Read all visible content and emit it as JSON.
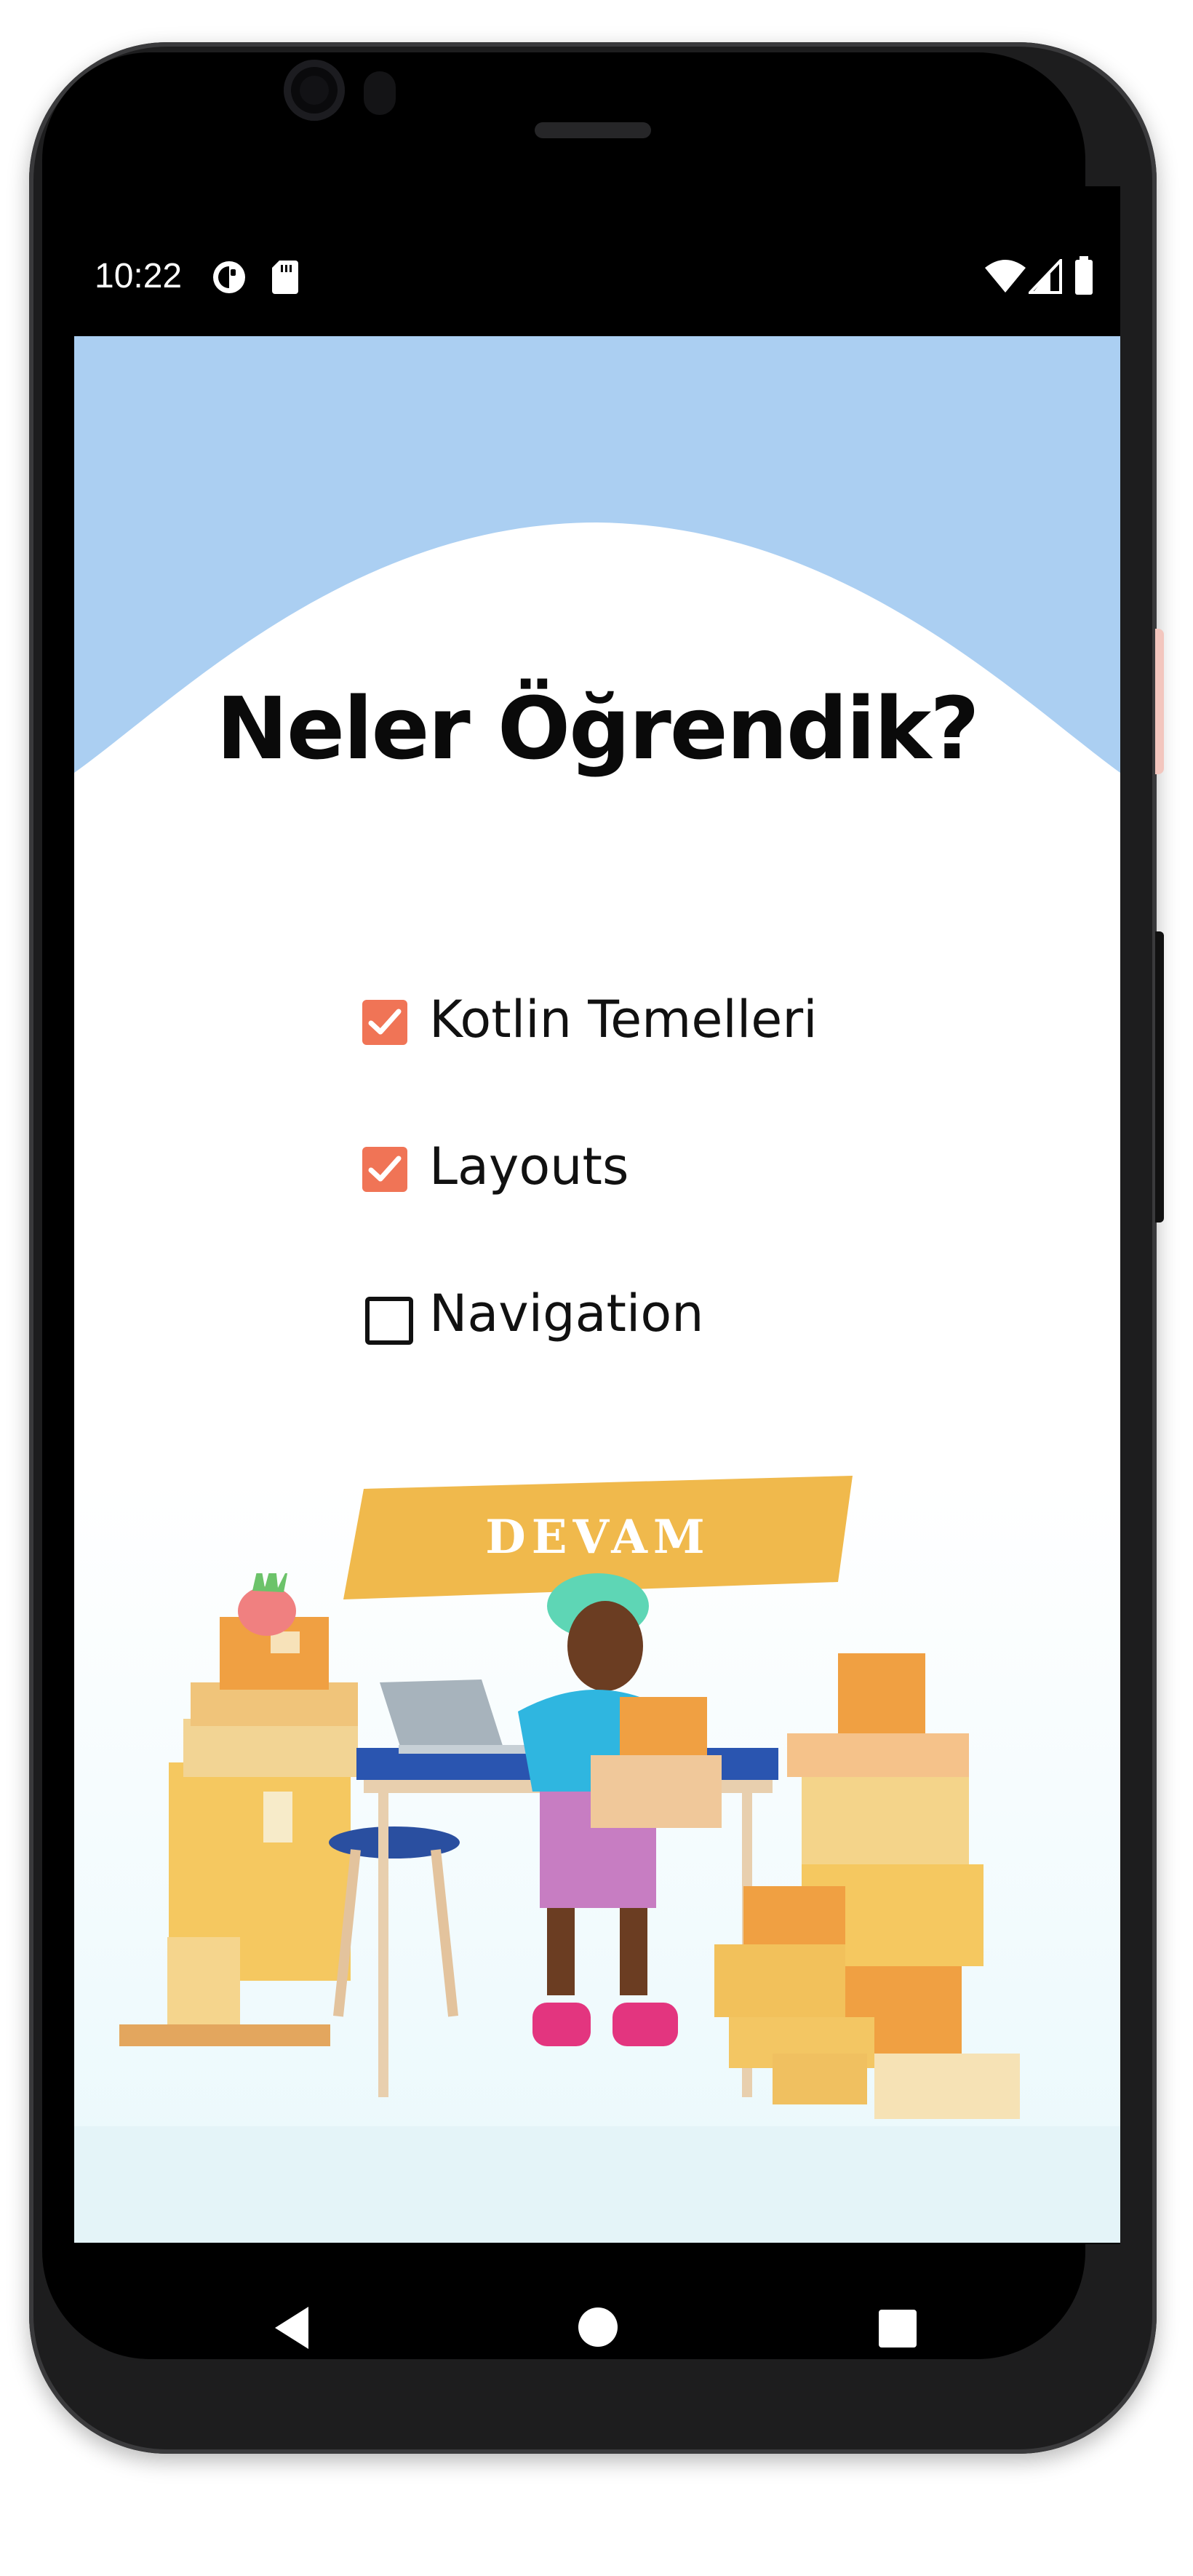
{
  "status_bar": {
    "time": "10:22",
    "left_icons": [
      "data-saver-icon",
      "sd-card-icon"
    ],
    "right_icons": [
      "wifi-icon",
      "cell-signal-icon",
      "battery-icon"
    ]
  },
  "screen": {
    "title": "Neler Öğrendik?",
    "checklist": [
      {
        "label": "Kotlin Temelleri",
        "checked": true
      },
      {
        "label": "Layouts",
        "checked": true
      },
      {
        "label": "Navigation",
        "checked": false
      }
    ],
    "continue_button": "DEVAM"
  },
  "navigation_bar": {
    "buttons": [
      "back-icon",
      "home-icon",
      "recents-icon"
    ]
  },
  "colors": {
    "header_blue": "#abcff2",
    "checkbox_orange": "#f07456",
    "button_yellow": "#f0b94c"
  }
}
